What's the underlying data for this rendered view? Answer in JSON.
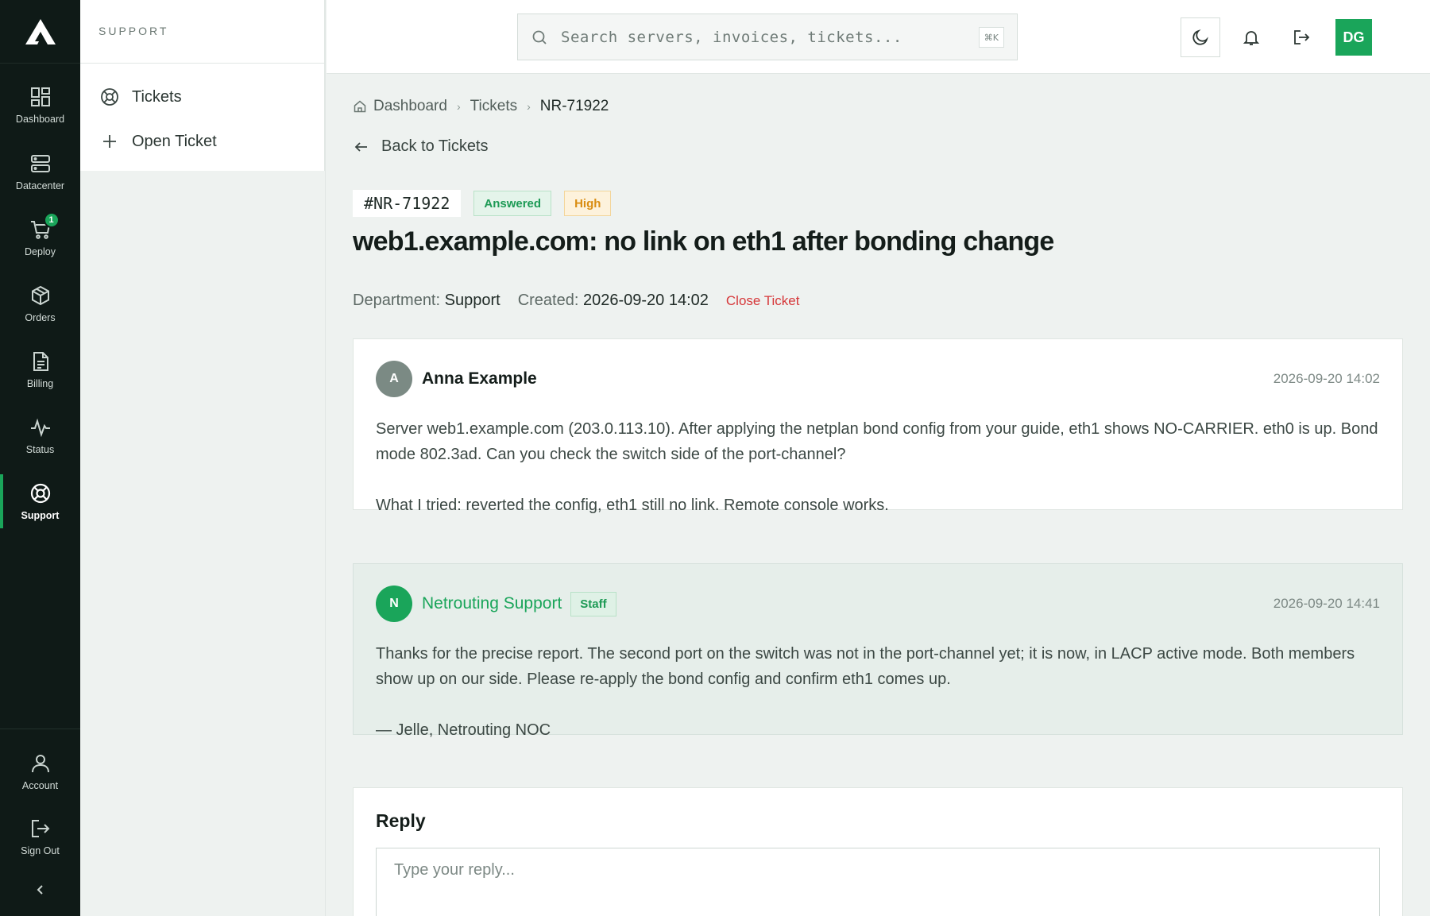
{
  "brand": {
    "accent": "#1aa55a",
    "rail_bg": "#0f1a17",
    "danger": "#d6383a",
    "warning": "#d98d12"
  },
  "rail": {
    "items": [
      {
        "label": "Dashboard",
        "icon": "dashboard-grid-icon"
      },
      {
        "label": "Datacenter",
        "icon": "server-stack-icon"
      },
      {
        "label": "Deploy",
        "icon": "cart-icon",
        "badge": "1"
      },
      {
        "label": "Orders",
        "icon": "package-icon"
      },
      {
        "label": "Billing",
        "icon": "document-icon"
      },
      {
        "label": "Status",
        "icon": "activity-icon"
      },
      {
        "label": "Support",
        "icon": "lifebuoy-icon",
        "active": true
      }
    ],
    "bottom": [
      {
        "label": "Account",
        "icon": "user-icon"
      },
      {
        "label": "Sign Out",
        "icon": "sign-out-icon"
      }
    ],
    "collapse_icon": "chevron-left-icon"
  },
  "subnav": {
    "heading": "SUPPORT",
    "items": [
      {
        "label": "Tickets",
        "icon": "lifebuoy-icon"
      },
      {
        "label": "Open Ticket",
        "icon": "plus-icon"
      }
    ]
  },
  "topbar": {
    "search_placeholder": "Search servers, invoices, tickets...",
    "shortcut": "⌘K",
    "user_initials": "DG"
  },
  "breadcrumb": {
    "home": "Dashboard",
    "section": "Tickets",
    "current": "NR-71922"
  },
  "back_label": "Back to Tickets",
  "ticket": {
    "id": "#NR-71922",
    "status": "Answered",
    "priority": "High",
    "title": "web1.example.com: no link on eth1 after bonding change",
    "department_label": "Department:",
    "department": "Support",
    "created_label": "Created:",
    "created": "2026-09-20 14:02",
    "close_label": "Close Ticket"
  },
  "messages": [
    {
      "initial": "A",
      "author": "Anna Example",
      "time": "2026-09-20 14:02",
      "paragraphs": [
        "Server web1.example.com (203.0.113.10). After applying the netplan bond config from your guide, eth1 shows NO-CARRIER. eth0 is up. Bond mode 802.3ad. Can you check the switch side of the port-channel?",
        "What I tried: reverted the config, eth1 still no link. Remote console works."
      ]
    },
    {
      "initial": "N",
      "author": "Netrouting Support",
      "badge": "Staff",
      "time": "2026-09-20 14:41",
      "paragraphs": [
        "Thanks for the precise report. The second port on the switch was not in the port-channel yet; it is now, in LACP active mode. Both members show up on our side. Please re-apply the bond config and confirm eth1 comes up.",
        "— Jelle, Netrouting NOC"
      ]
    }
  ],
  "reply": {
    "heading": "Reply",
    "placeholder": "Type your reply..."
  }
}
